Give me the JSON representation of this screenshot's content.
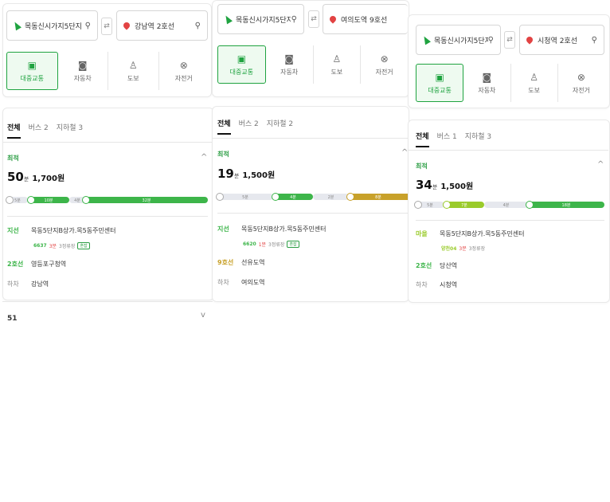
{
  "colors": {
    "accent": "#1fa340",
    "bus_green": "#3db54a",
    "line2_green": "#3db54a",
    "line9_gold": "#c8a12a",
    "branch_bus_lime": "#9acb2b"
  },
  "panels": [
    {
      "origin": "목동신시가지5단지",
      "destination": "강남역 2호선",
      "modes": [
        {
          "icon": "bus-icon",
          "label": "대중교통"
        },
        {
          "icon": "car-icon",
          "label": "자동차"
        },
        {
          "icon": "walk-icon",
          "label": "도보"
        },
        {
          "icon": "bike-icon",
          "label": "자전거"
        }
      ],
      "tabs": [
        "전체",
        "버스 2",
        "지하철 3"
      ],
      "result": {
        "best_label": "최적",
        "minutes": "50",
        "min_unit": "분",
        "fare": "1,700원",
        "segments": [
          {
            "kind": "walk",
            "label": "5분"
          },
          {
            "kind": "bus",
            "label": "10분"
          },
          {
            "kind": "walk",
            "label": "4분"
          },
          {
            "kind": "subway",
            "label": "32분"
          }
        ],
        "steps": [
          {
            "tag": "지선",
            "text": "목동5단지B상가.목5동주민센터",
            "detail_bus": "6637",
            "detail_eta": "3분",
            "detail_stops": "3정류장",
            "detail_chip": "혼잡"
          },
          {
            "tag": "2호선",
            "text": "영등포구청역"
          },
          {
            "tag": "하차",
            "text": "강남역"
          }
        ]
      },
      "next_label": "51"
    },
    {
      "origin": "목동신시가지5단지",
      "destination": "여의도역 9호선",
      "modes": [
        {
          "icon": "bus-icon",
          "label": "대중교통"
        },
        {
          "icon": "car-icon",
          "label": "자동차"
        },
        {
          "icon": "walk-icon",
          "label": "도보"
        },
        {
          "icon": "bike-icon",
          "label": "자전거"
        }
      ],
      "tabs": [
        "전체",
        "버스 2",
        "지하철 2"
      ],
      "result": {
        "best_label": "최적",
        "minutes": "19",
        "min_unit": "분",
        "fare": "1,500원",
        "segments": [
          {
            "kind": "walk",
            "label": "5분"
          },
          {
            "kind": "bus",
            "label": "4분"
          },
          {
            "kind": "walk",
            "label": "2분"
          },
          {
            "kind": "subway9",
            "label": "8분"
          }
        ],
        "steps": [
          {
            "tag": "지선",
            "text": "목동5단지B상가.목5동주민센터",
            "detail_bus": "6620",
            "detail_eta": "1분",
            "detail_stops": "3정류장",
            "detail_chip": "혼잡"
          },
          {
            "tag": "9호선",
            "text": "선유도역"
          },
          {
            "tag": "하차",
            "text": "여의도역"
          }
        ]
      }
    },
    {
      "origin": "목동신시가지5단지",
      "destination": "시청역 2호선",
      "modes": [
        {
          "icon": "bus-icon",
          "label": "대중교통"
        },
        {
          "icon": "car-icon",
          "label": "자동차"
        },
        {
          "icon": "walk-icon",
          "label": "도보"
        },
        {
          "icon": "bike-icon",
          "label": "자전거"
        }
      ],
      "tabs": [
        "전체",
        "버스 1",
        "지하철 3"
      ],
      "result": {
        "best_label": "최적",
        "minutes": "34",
        "min_unit": "분",
        "fare": "1,500원",
        "segments": [
          {
            "kind": "walk",
            "label": "5분"
          },
          {
            "kind": "bus_lime",
            "label": "7분"
          },
          {
            "kind": "walk",
            "label": "4분"
          },
          {
            "kind": "subway",
            "label": "18분"
          }
        ],
        "steps": [
          {
            "tag": "마을",
            "text": "목동5단지B상가.목5동주민센터",
            "detail_bus": "양천04",
            "detail_eta": "3분",
            "detail_stops": "3정류장"
          },
          {
            "tag": "2호선",
            "text": "당산역"
          },
          {
            "tag": "하차",
            "text": "시청역"
          }
        ]
      }
    }
  ]
}
